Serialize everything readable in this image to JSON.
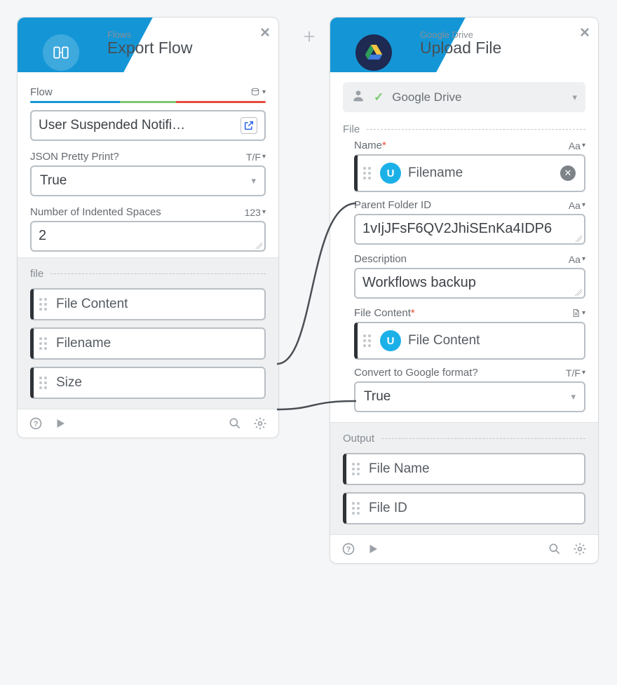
{
  "left": {
    "category": "Flows",
    "title": "Export Flow",
    "flow_label": "Flow",
    "flow_value": "User Suspended Notifi…",
    "json_pretty_label": "JSON Pretty Print?",
    "json_pretty_type": "T/F",
    "json_pretty_value": "True",
    "indent_label": "Number of Indented Spaces",
    "indent_type": "123",
    "indent_value": "2",
    "file_section_label": "file",
    "outputs": [
      {
        "label": "File Content"
      },
      {
        "label": "Filename"
      },
      {
        "label": "Size"
      }
    ]
  },
  "right": {
    "category": "Google Drive",
    "title": "Upload File",
    "connection_name": "Google Drive",
    "file_section_label": "File",
    "name_label": "Name",
    "name_type": "Aa",
    "name_pill": "Filename",
    "parent_label": "Parent Folder ID",
    "parent_type": "Aa",
    "parent_value": "1vIjJFsF6QV2JhiSEnKa4IDP6",
    "description_label": "Description",
    "description_type": "Aa",
    "description_value": "Workflows backup",
    "filecontent_label": "File Content",
    "filecontent_pill": "File Content",
    "convert_label": "Convert to Google format?",
    "convert_type": "T/F",
    "convert_value": "True",
    "output_section_label": "Output",
    "outputs": [
      {
        "label": "File Name"
      },
      {
        "label": "File ID"
      }
    ]
  }
}
